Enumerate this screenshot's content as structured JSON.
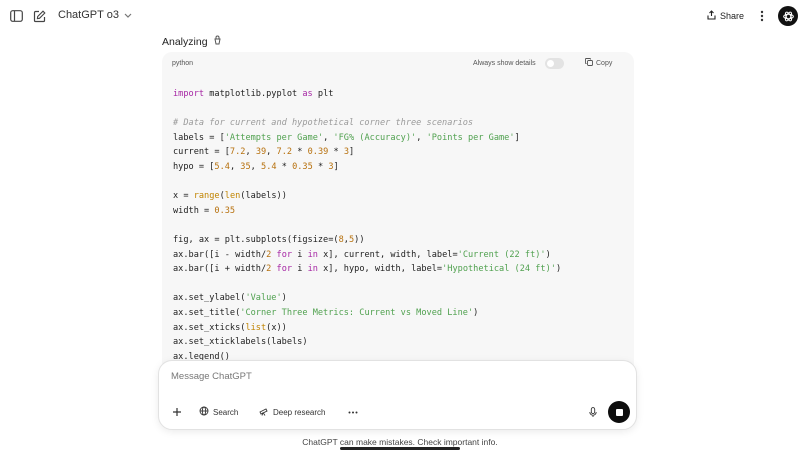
{
  "header": {
    "model_name": "ChatGPT o3",
    "share_label": "Share"
  },
  "status": {
    "label": "Analyzing"
  },
  "code_block": {
    "language": "python",
    "always_show_label": "Always show details",
    "always_show_on": false,
    "copy_label": "Copy"
  },
  "composer": {
    "placeholder": "Message ChatGPT",
    "value": "",
    "search_label": "Search",
    "deep_research_label": "Deep research"
  },
  "footer": {
    "disclaimer": "ChatGPT can make mistakes. Check important info."
  },
  "icons": [
    "sidebar-toggle-icon",
    "new-chat-icon",
    "chevron-down-icon",
    "share-icon",
    "more-icon",
    "openai-logo-icon",
    "atom-icon",
    "copy-icon",
    "plus-icon",
    "globe-icon",
    "telescope-icon",
    "mic-icon",
    "stop-icon"
  ]
}
